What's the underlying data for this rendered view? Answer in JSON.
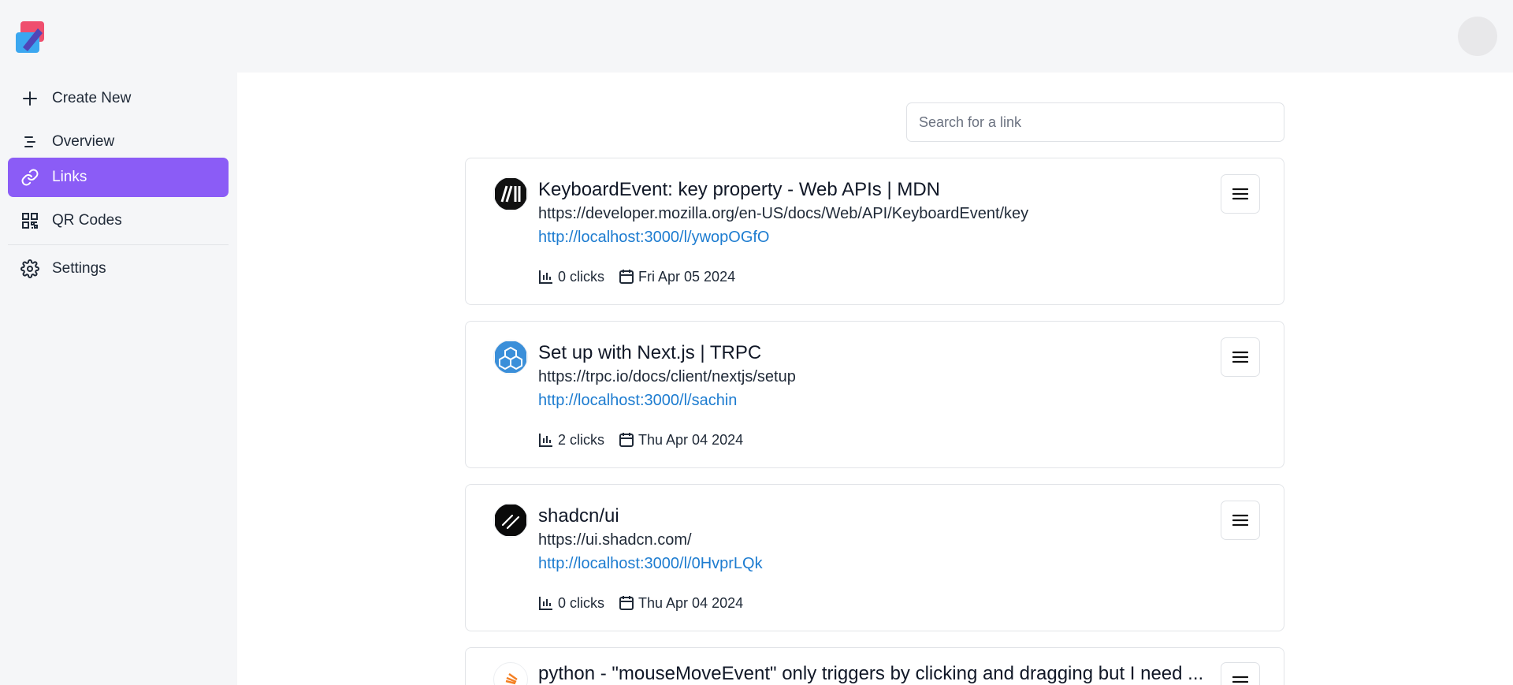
{
  "header": {
    "logo_icon": "app-logo",
    "avatar_icon": "user-avatar"
  },
  "sidebar": {
    "items": [
      {
        "label": "Create New",
        "icon": "plus-icon",
        "active": false
      },
      {
        "label": "Overview",
        "icon": "overview-icon",
        "active": false
      },
      {
        "label": "Links",
        "icon": "link-icon",
        "active": true
      },
      {
        "label": "QR Codes",
        "icon": "qr-code-icon",
        "active": false
      },
      {
        "label": "Settings",
        "icon": "gear-icon",
        "active": false
      }
    ],
    "active_color": "#8b5cf6"
  },
  "search": {
    "placeholder": "Search for a link",
    "value": ""
  },
  "links": [
    {
      "title": "KeyboardEvent: key property - Web APIs | MDN",
      "url": "https://developer.mozilla.org/en-US/docs/Web/API/KeyboardEvent/key",
      "short_url": "http://localhost:3000/l/ywopOGfO",
      "clicks": "0 clicks",
      "date": "Fri Apr 05 2024",
      "favicon": "mdn-icon"
    },
    {
      "title": "Set up with Next.js | TRPC",
      "url": "https://trpc.io/docs/client/nextjs/setup",
      "short_url": "http://localhost:3000/l/sachin",
      "clicks": "2 clicks",
      "date": "Thu Apr 04 2024",
      "favicon": "trpc-icon"
    },
    {
      "title": "shadcn/ui",
      "url": "https://ui.shadcn.com/",
      "short_url": "http://localhost:3000/l/0HvprLQk",
      "clicks": "0 clicks",
      "date": "Thu Apr 04 2024",
      "favicon": "shadcn-icon"
    },
    {
      "title": "python - \"mouseMoveEvent\" only triggers by clicking and dragging but I need ...",
      "favicon": "stackoverflow-icon"
    }
  ],
  "colors": {
    "short_link": "#1d7cd0",
    "sidebar_bg": "#f5f6f8"
  }
}
